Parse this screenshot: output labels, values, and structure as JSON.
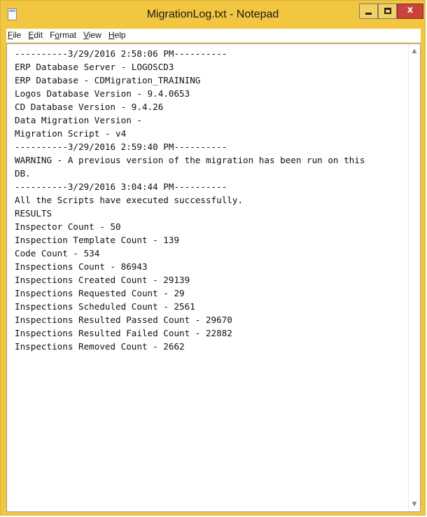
{
  "window": {
    "title": "MigrationLog.txt - Notepad",
    "controls": {
      "minimize_icon": "minimize-icon",
      "maximize_icon": "maximize-icon",
      "close_glyph": "x"
    },
    "accent_color": "#f2c640",
    "close_color": "#c9433a"
  },
  "menu": {
    "items": [
      {
        "label": "File",
        "mnemonic": "F"
      },
      {
        "label": "Edit",
        "mnemonic": "E"
      },
      {
        "label": "Format",
        "mnemonic": "o"
      },
      {
        "label": "View",
        "mnemonic": "V"
      },
      {
        "label": "Help",
        "mnemonic": "H"
      }
    ]
  },
  "document": {
    "lines": [
      "----------3/29/2016 2:58:06 PM----------",
      "ERP Database Server - LOGOSCD3",
      "ERP Database - CDMigration_TRAINING",
      "Logos Database Version - 9.4.0653",
      "CD Database Version - 9.4.26",
      "Data Migration Version -",
      "Migration Script - v4",
      "----------3/29/2016 2:59:40 PM----------",
      "WARNING - A previous version of the migration has been run on this",
      "DB.",
      "----------3/29/2016 3:04:44 PM----------",
      "All the Scripts have executed successfully.",
      "RESULTS",
      "Inspector Count - 50",
      "Inspection Template Count - 139",
      "Code Count - 534",
      "Inspections Count - 86943",
      "Inspections Created Count - 29139",
      "Inspections Requested Count - 29",
      "Inspections Scheduled Count - 2561",
      "Inspections Resulted Passed Count - 29670",
      "Inspections Resulted Failed Count - 22882",
      "Inspections Removed Count - 2662"
    ]
  },
  "scrollbar": {
    "up_icon": "chevron-up-icon",
    "down_icon": "chevron-down-icon"
  }
}
